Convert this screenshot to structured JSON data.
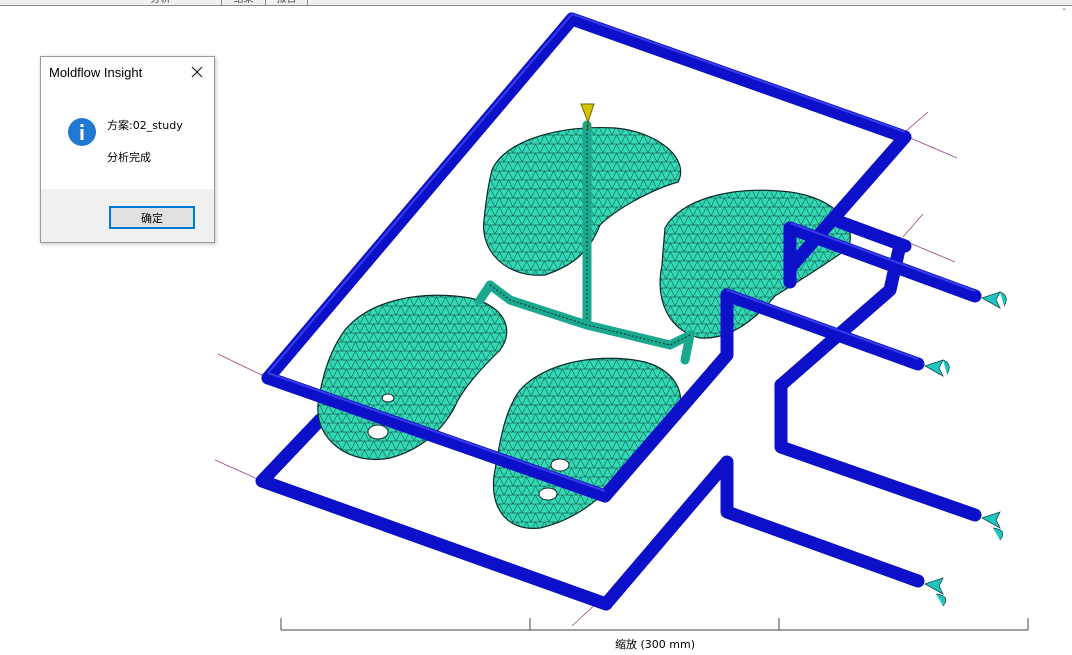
{
  "tabs": [
    {
      "label": "分析"
    },
    {
      "label": "结果"
    },
    {
      "label": "报告"
    }
  ],
  "dialog": {
    "title": "Moldflow Insight",
    "study_line": "方案:02_study",
    "message": "分析完成",
    "ok_label": "确定"
  },
  "scale": {
    "label": "缩放 (300 mm)"
  },
  "colors": {
    "cooling_channel": "#0c10c8",
    "mesh_fill": "#33d8b4",
    "mesh_edge": "#0a2a2a",
    "info_icon": "#1f78d1",
    "dialog_accent": "#0078d7",
    "injection_marker": "#d9c400",
    "axis_line": "#8a2a7a"
  },
  "icons": {
    "info": "info-icon",
    "close": "close-icon",
    "injection": "injection-point-icon",
    "coolant": "coolant-inlet-icon"
  }
}
